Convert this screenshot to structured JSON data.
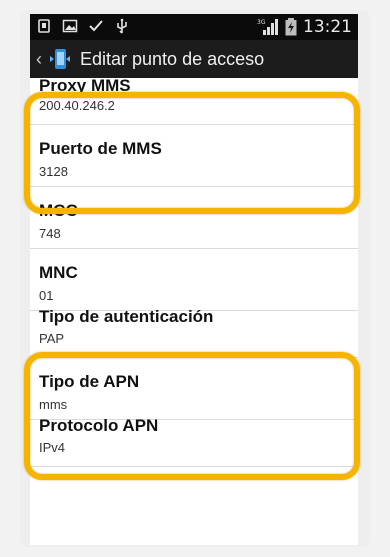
{
  "status_bar": {
    "time": "13:21",
    "icons": [
      "usb-icon",
      "image-icon",
      "check-icon",
      "usb-icon",
      "signal-3g-icon",
      "battery-charging-icon"
    ]
  },
  "action_bar": {
    "title": "Editar punto de acceso",
    "back_icon": "back-chevron-icon",
    "app_icon": "apn-settings-icon"
  },
  "settings": [
    {
      "label": "Proxy MMS",
      "value": "200.40.246.2"
    },
    {
      "label": "Puerto de MMS",
      "value": "3128"
    },
    {
      "label": "MCC",
      "value": "748"
    },
    {
      "label": "MNC",
      "value": "01"
    },
    {
      "label": "Tipo de autenticación",
      "value": "PAP"
    },
    {
      "label": "Tipo de APN",
      "value": "mms"
    },
    {
      "label": "Protocolo APN",
      "value": "IPv4"
    }
  ],
  "colors": {
    "highlight": "#f4b400",
    "status_bar_bg": "#0b0b0b",
    "action_bar_bg": "#1c1c1c"
  }
}
